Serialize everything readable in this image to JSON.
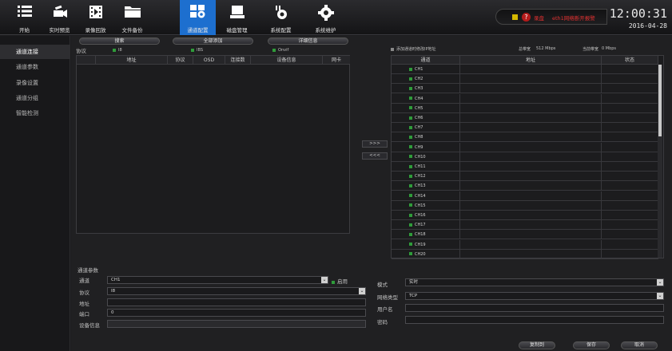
{
  "nav": {
    "items": [
      {
        "label": "开始",
        "icon": "menu-icon"
      },
      {
        "label": "实时预览",
        "icon": "camera-icon"
      },
      {
        "label": "录像回放",
        "icon": "film-icon"
      },
      {
        "label": "文件备份",
        "icon": "folder-icon"
      },
      {
        "label": "通道配置",
        "icon": "channel-config-icon"
      },
      {
        "label": "磁盘管理",
        "icon": "disk-icon"
      },
      {
        "label": "系统配置",
        "icon": "system-config-icon"
      },
      {
        "label": "系统维护",
        "icon": "gear-icon"
      }
    ],
    "active_index": 4
  },
  "status": {
    "record_label": "录盘",
    "net_label": "eth1网络断开报警",
    "time": "12:00:31",
    "date": "2016-04-28"
  },
  "sidebar": {
    "items": [
      {
        "label": "通道连接"
      },
      {
        "label": "通道参数"
      },
      {
        "label": "录像设置"
      },
      {
        "label": "通道分组"
      },
      {
        "label": "智能检测"
      }
    ],
    "active_index": 0
  },
  "search": {
    "search_label": "搜索",
    "add_all_label": "全部添加",
    "detail_label": "详细信息",
    "protocol_label": "协议",
    "protocols": [
      "I8",
      "IBS",
      "Onvif"
    ]
  },
  "left_table": {
    "headers": [
      "地址",
      "协议",
      "OSD",
      "连接数",
      "设备信息",
      "网卡"
    ]
  },
  "transfer": {
    "add_label": ">>>",
    "remove_label": "<<<"
  },
  "right_panel": {
    "add_modify_label": "添加通道时修改IP地址",
    "total_bw_label": "总带宽",
    "total_bw_value": "512 Mbps",
    "current_bw_label": "当前带宽",
    "current_bw_value": "0 Mbps",
    "headers": [
      "通道",
      "地址",
      "状态"
    ],
    "channels": [
      "CH1",
      "CH2",
      "CH3",
      "CH4",
      "CH5",
      "CH6",
      "CH7",
      "CH8",
      "CH9",
      "CH10",
      "CH11",
      "CH12",
      "CH13",
      "CH14",
      "CH15",
      "CH16",
      "CH17",
      "CH18",
      "CH19",
      "CH20"
    ]
  },
  "params": {
    "section_label": "通道参数",
    "channel_label": "通道",
    "channel_value": "CH1",
    "enable_label": "启用",
    "protocol_label": "协议",
    "protocol_value": "I8",
    "address_label": "地址",
    "address_value": "",
    "port_label": "端口",
    "port_value": "0",
    "device_info_label": "设备信息",
    "device_info_value": "",
    "mode_label": "模式",
    "mode_value": "实时",
    "net_type_label": "网络类型",
    "net_type_value": "TCP",
    "username_label": "用户名",
    "username_value": "",
    "password_label": "密码",
    "password_value": ""
  },
  "buttons": {
    "copy_label": "复制到",
    "save_label": "保存",
    "cancel_label": "取消"
  },
  "colors": {
    "accent": "#1d6fcf",
    "check": "#2f9c3a",
    "alarm": "#e03030"
  }
}
